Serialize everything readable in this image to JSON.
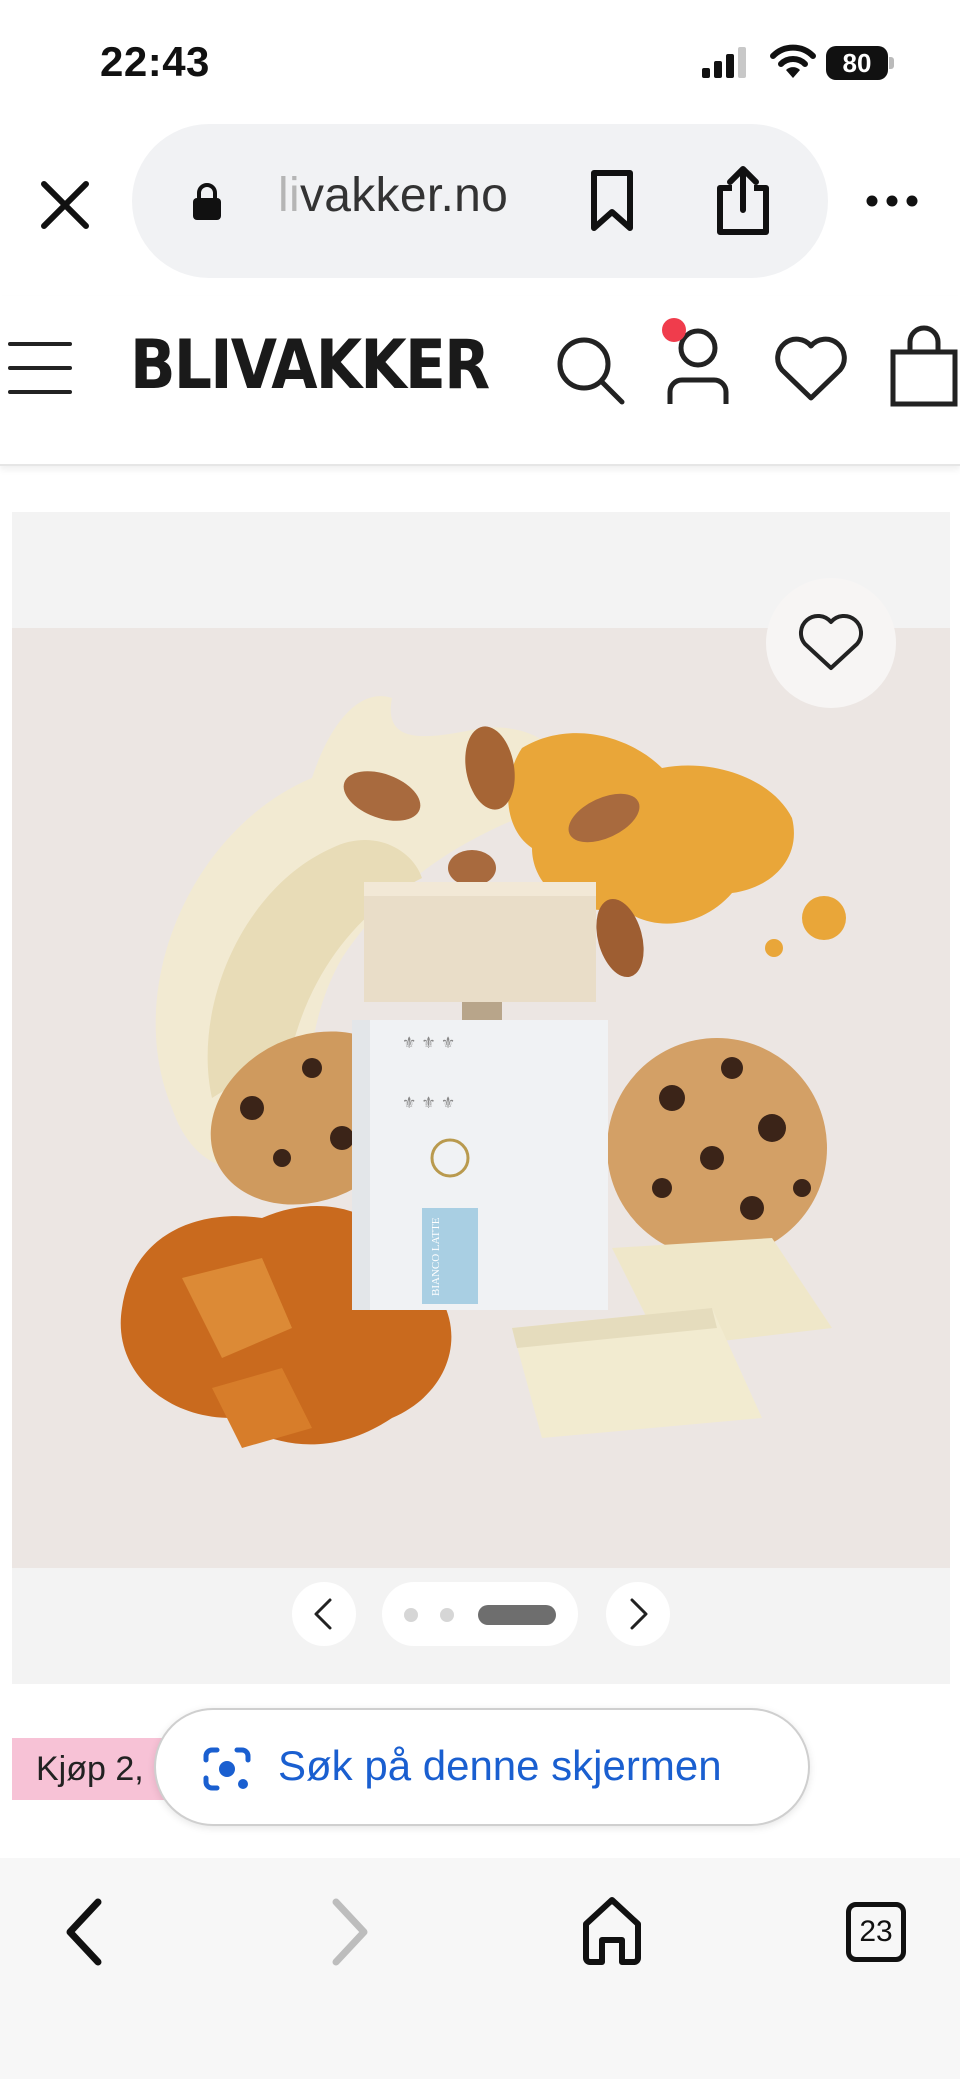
{
  "status_bar": {
    "time": "22:43",
    "battery_level": "80"
  },
  "browser": {
    "url_faded": "li",
    "url_main": "vakker.no"
  },
  "site": {
    "brand": "BLIVAKKER",
    "has_notification_dot": true
  },
  "gallery": {
    "product_label": "BIANCO LATTE",
    "image_count": 3,
    "active_index": 2
  },
  "promo": {
    "tag_text": "Kjøp 2,"
  },
  "lens": {
    "label": "Søk på denne skjermen"
  },
  "toolbar": {
    "tab_count": "23"
  },
  "colors": {
    "brand_text": "#1a1a1a",
    "notification": "#f03c4c",
    "lens_blue": "#1a5fd0",
    "promo_pink": "#f7c2d6"
  }
}
